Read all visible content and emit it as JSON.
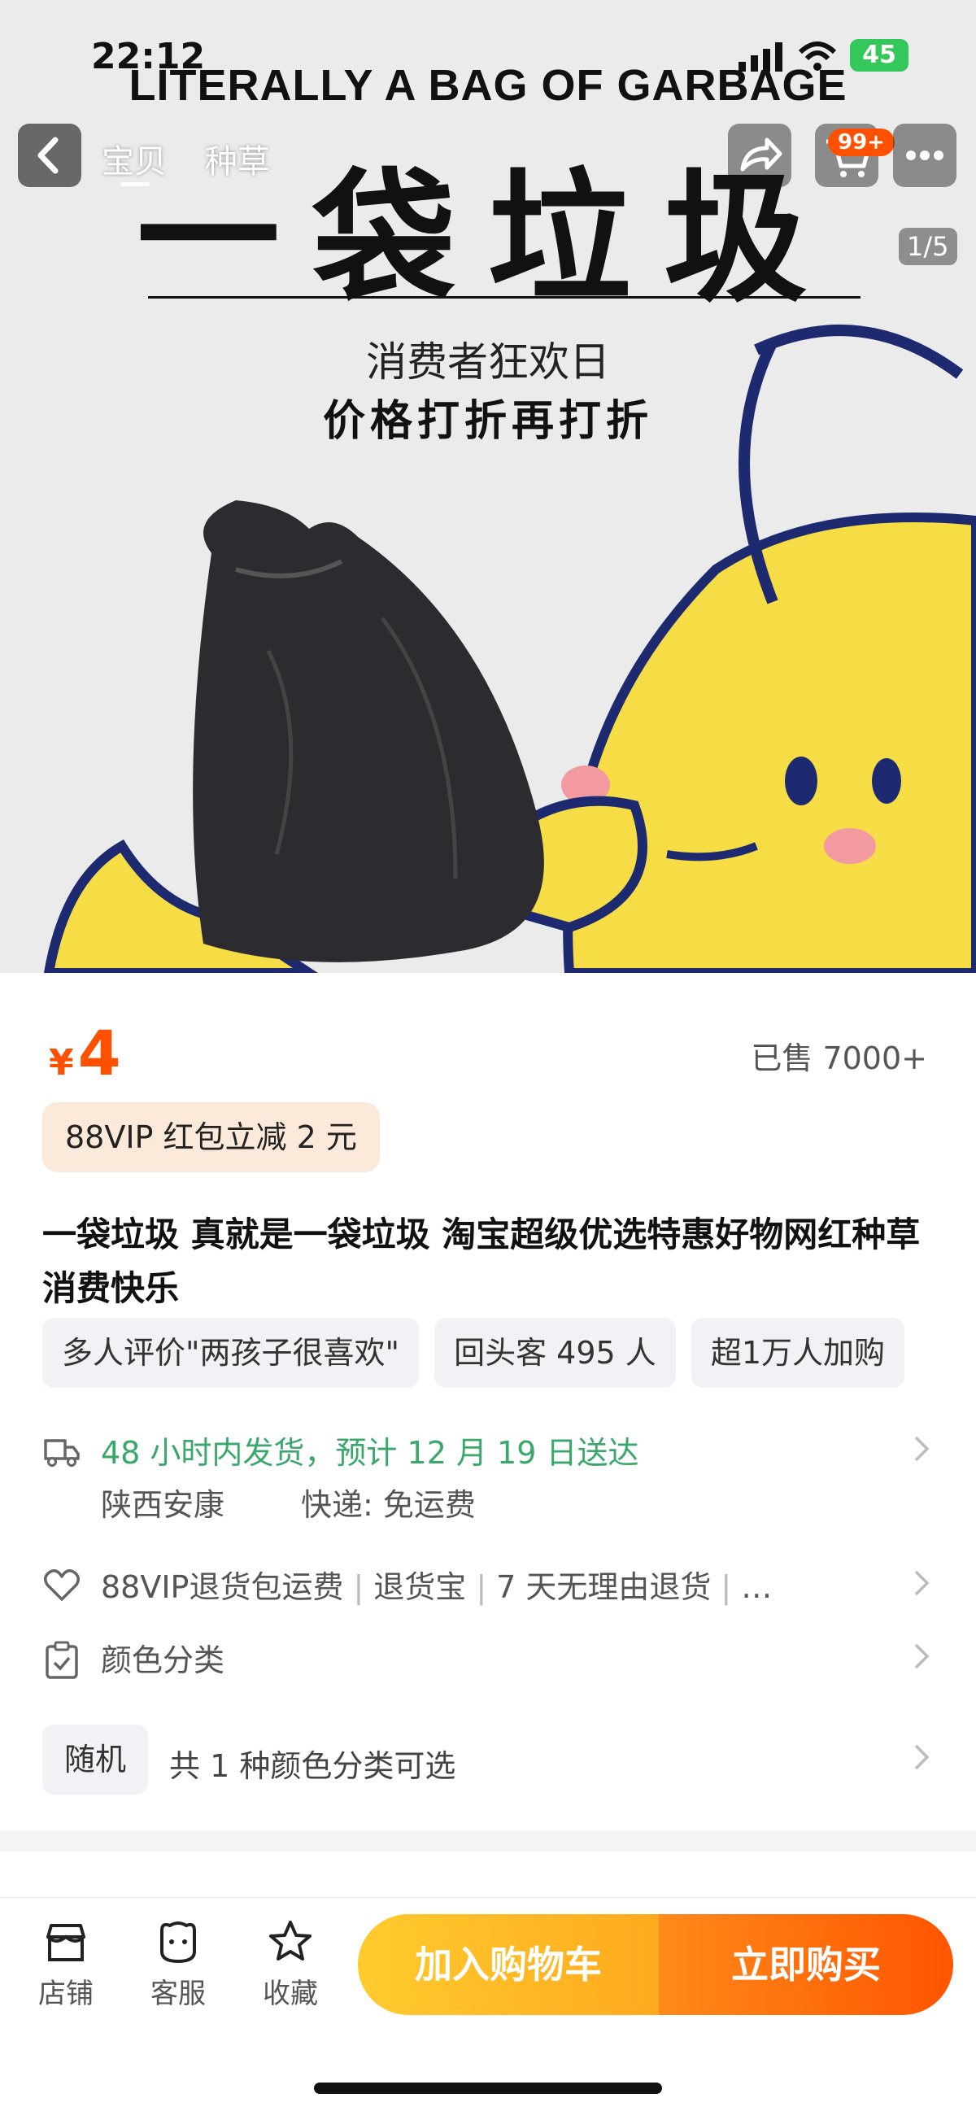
{
  "meme_caption": "LITERALLY A BAG OF GARBAGE",
  "status": {
    "time": "22:12",
    "battery": "45"
  },
  "nav": {
    "tabs": [
      "宝贝",
      "种草"
    ],
    "cart_badge": "99+",
    "image_counter": "1/5"
  },
  "hero": {
    "title": "一袋垃圾",
    "subtitle": "消费者狂欢日",
    "tagline": "价格打折再打折"
  },
  "price": {
    "symbol": "¥",
    "value": "4",
    "sold": "已售 7000+"
  },
  "vip_offer": "88VIP 红包立减 2 元",
  "product_title": "一袋垃圾 真就是一袋垃圾 淘宝超级优选特惠好物网红种草消费快乐",
  "tags": [
    "多人评价\"两孩子很喜欢\"",
    "回头客 495 人",
    "超1万人加购"
  ],
  "shipping": {
    "delivery": "48 小时内发货，预计 12 月 19 日送达",
    "origin": "陕西安康",
    "express": "快递: 免运费"
  },
  "services": {
    "items": [
      "88VIP退货包运费",
      "退货宝",
      "7 天无理由退货"
    ],
    "more": "…"
  },
  "color_category": "颜色分类",
  "variant": {
    "chip": "随机",
    "text": "共 1 种颜色分类可选"
  },
  "bottom_bar": {
    "shop": "店铺",
    "service": "客服",
    "favorite": "收藏",
    "add_to_cart": "加入购物车",
    "buy_now": "立即购买"
  },
  "colors": {
    "accent": "#ff5000",
    "green": "#3aa86b",
    "cart_yellow": "#ffb81f"
  },
  "icons": [
    "chevron-left-icon",
    "share-icon",
    "cart-icon",
    "more-icon",
    "truck-icon",
    "heart-icon",
    "clipboard-icon",
    "chevron-right-icon",
    "shop-icon",
    "service-icon",
    "star-icon"
  ]
}
